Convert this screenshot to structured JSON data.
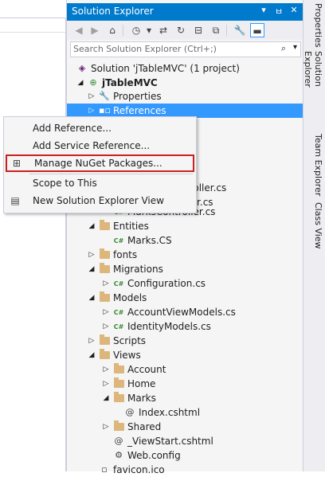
{
  "panel": {
    "title": "Solution Explorer",
    "title_buttons": [
      "▾",
      "📌",
      "✕"
    ],
    "search_placeholder": "Search Solution Explorer (Ctrl+;)"
  },
  "side_tabs": [
    "Properties",
    "Solution Explorer",
    "Team Explorer",
    "Class View"
  ],
  "tree": [
    {
      "label": "Solution 'jTableMVC' (1 project)",
      "icon": "solution-icon",
      "arrow": "",
      "level": 0
    },
    {
      "label": "jTableMVC",
      "icon": "csharp-project-icon",
      "arrow": "◢",
      "level": 1,
      "bold": true
    },
    {
      "label": "Properties",
      "icon": "wrench-icon",
      "arrow": "▷",
      "level": 2
    },
    {
      "label": "References",
      "icon": "references-icon",
      "arrow": "▷",
      "level": 2,
      "selected": true
    },
    {
      "label": "MarksController.cs",
      "icon": "csharp-file-icon",
      "arrow": "",
      "level": 3
    },
    {
      "label": "Entities",
      "icon": "folder-icon",
      "arrow": "◢",
      "level": 2
    },
    {
      "label": "Marks.CS",
      "icon": "csharp-file-icon",
      "arrow": "",
      "level": 3
    },
    {
      "label": "fonts",
      "icon": "folder-icon",
      "arrow": "▷",
      "level": 2
    },
    {
      "label": "Migrations",
      "icon": "folder-icon",
      "arrow": "◢",
      "level": 2
    },
    {
      "label": "Configuration.cs",
      "icon": "csharp-file-icon",
      "arrow": "▷",
      "level": 3
    },
    {
      "label": "Models",
      "icon": "folder-icon",
      "arrow": "◢",
      "level": 2
    },
    {
      "label": "AccountViewModels.cs",
      "icon": "csharp-file-icon",
      "arrow": "▷",
      "level": 3
    },
    {
      "label": "IdentityModels.cs",
      "icon": "csharp-file-icon",
      "arrow": "▷",
      "level": 3
    },
    {
      "label": "Scripts",
      "icon": "folder-icon",
      "arrow": "▷",
      "level": 2
    },
    {
      "label": "Views",
      "icon": "folder-icon",
      "arrow": "◢",
      "level": 2
    },
    {
      "label": "Account",
      "icon": "folder-icon",
      "arrow": "▷",
      "level": 3
    },
    {
      "label": "Home",
      "icon": "folder-icon",
      "arrow": "▷",
      "level": 3
    },
    {
      "label": "Marks",
      "icon": "folder-icon",
      "arrow": "◢",
      "level": 3
    },
    {
      "label": "Index.cshtml",
      "icon": "razor-icon",
      "arrow": "",
      "level": 4
    },
    {
      "label": "Shared",
      "icon": "folder-icon",
      "arrow": "▷",
      "level": 3
    },
    {
      "label": "_ViewStart.cshtml",
      "icon": "razor-icon",
      "arrow": "",
      "level": 3
    },
    {
      "label": "Web.config",
      "icon": "config-icon",
      "arrow": "",
      "level": 3
    },
    {
      "label": "favicon.ico",
      "icon": "file-icon",
      "arrow": "",
      "level": 2
    }
  ],
  "hidden_fragments": [
    "troller.cs",
    "ller.cs"
  ],
  "context_menu": [
    {
      "label": "Add Reference...",
      "icon": ""
    },
    {
      "label": "Add Service Reference...",
      "icon": ""
    },
    {
      "label": "Manage NuGet Packages...",
      "icon": "nuget-icon",
      "highlighted": true
    },
    {
      "label": "Scope to This",
      "icon": ""
    },
    {
      "label": "New Solution Explorer View",
      "icon": "new-view-icon"
    }
  ]
}
